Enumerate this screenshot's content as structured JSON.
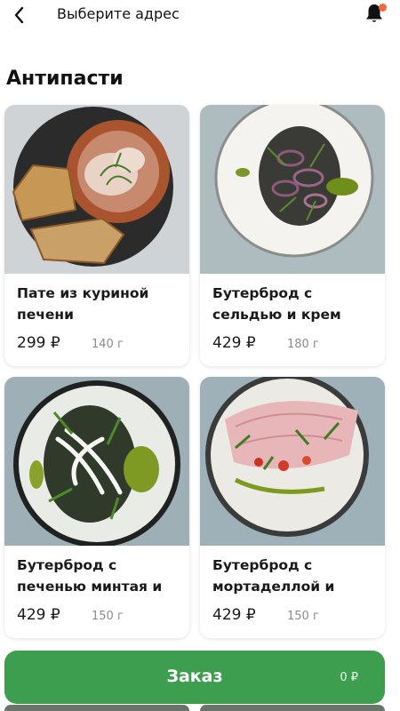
{
  "header": {
    "title": "Выберите адрес",
    "notification_dot_color": "#f2673d"
  },
  "section": {
    "title": "Антипасти"
  },
  "products": [
    {
      "name": "Пате из куриной печени",
      "price": "299 ₽",
      "weight": "140 г",
      "image": "chicken-liver-pate-photo"
    },
    {
      "name": "Бутерброд с сельдью и крем",
      "price": "429 ₽",
      "weight": "180 г",
      "image": "herring-sandwich-photo"
    },
    {
      "name": "Бутерброд с печенью минтая и",
      "price": "429 ₽",
      "weight": "150 г",
      "image": "pollock-liver-sandwich-photo"
    },
    {
      "name": "Бутерброд с мортаделлой и",
      "price": "429 ₽",
      "weight": "150 г",
      "image": "mortadella-sandwich-photo"
    }
  ],
  "order": {
    "label": "Заказ",
    "sum": "0 ₽",
    "color": "#3e9e4f"
  }
}
